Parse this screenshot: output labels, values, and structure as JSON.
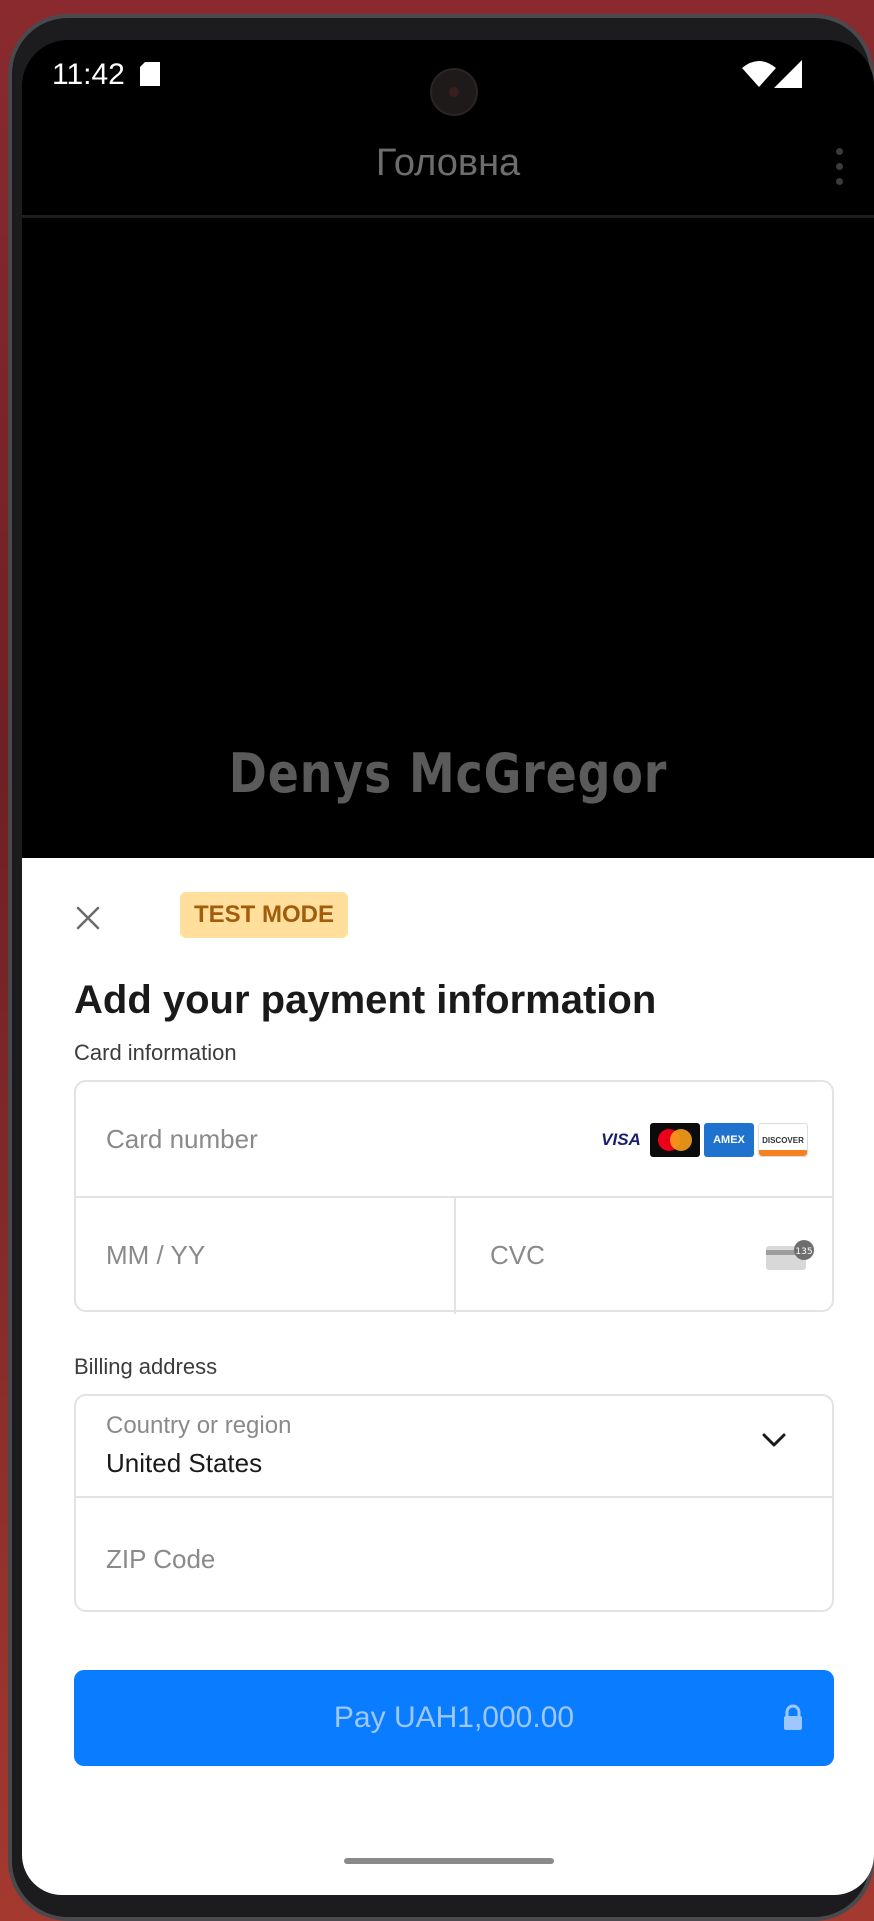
{
  "status_bar": {
    "time": "11:42"
  },
  "app_bar": {
    "title": "Головна"
  },
  "hero": {
    "name": "Denys McGregor"
  },
  "sheet": {
    "badge": "TEST MODE",
    "title": "Add your payment information",
    "card_section_label": "Card information",
    "card_number_placeholder": "Card number",
    "expiry_placeholder": "MM / YY",
    "cvc_placeholder": "CVC",
    "card_brands": [
      "VISA",
      "mastercard",
      "AMEX",
      "DISCOVER"
    ],
    "billing_section_label": "Billing address",
    "country_label": "Country or region",
    "country_value": "United States",
    "zip_placeholder": "ZIP Code",
    "pay_button_label": "Pay UAH1,000.00"
  },
  "colors": {
    "accent": "#0a7cff",
    "badge_bg": "#ffdf9b",
    "badge_text": "#a15c0c"
  },
  "icons": [
    "sim-card-icon",
    "wifi-icon",
    "signal-icon",
    "overflow-menu-icon",
    "close-icon",
    "cvc-card-icon",
    "chevron-down-icon",
    "lock-icon"
  ]
}
